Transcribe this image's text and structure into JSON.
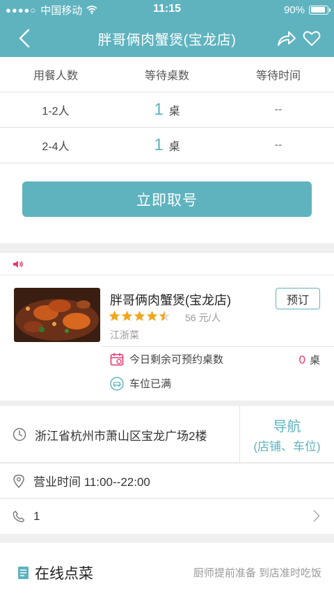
{
  "status_bar": {
    "carrier": "中国移动",
    "time": "11:15",
    "battery": "90%",
    "battery_level": 0.9
  },
  "nav": {
    "title": "胖哥俩肉蟹煲(宝龙店)"
  },
  "queue": {
    "headers": [
      "用餐人数",
      "等待桌数",
      "等待时间"
    ],
    "rows": [
      {
        "size": "1-2人",
        "count": "1",
        "unit": "桌",
        "wait": "--"
      },
      {
        "size": "2-4人",
        "count": "1",
        "unit": "桌",
        "wait": "--"
      }
    ],
    "button": "立即取号"
  },
  "shop": {
    "name": "胖哥俩肉蟹煲(宝龙店)",
    "rating": 4.5,
    "price": "56 元/人",
    "cuisine": "江浙菜",
    "reserve": "预订",
    "avail_label": "今日剩余可预约桌数",
    "avail_num": "0",
    "avail_unit": "桌",
    "parking": "车位已满"
  },
  "address": {
    "text": "浙江省杭州市萧山区宝龙广场2楼",
    "nav1": "导航",
    "nav2": "(店铺、车位)"
  },
  "hours": "营业时间 11:00--22:00",
  "phone": "1",
  "order": {
    "title": "在线点菜",
    "subtitle": "厨师提前准备 到店准时吃饭"
  },
  "colors": {
    "accent": "#5fb3bf",
    "highlight": "#e8396d",
    "star": "#f2a51a"
  }
}
